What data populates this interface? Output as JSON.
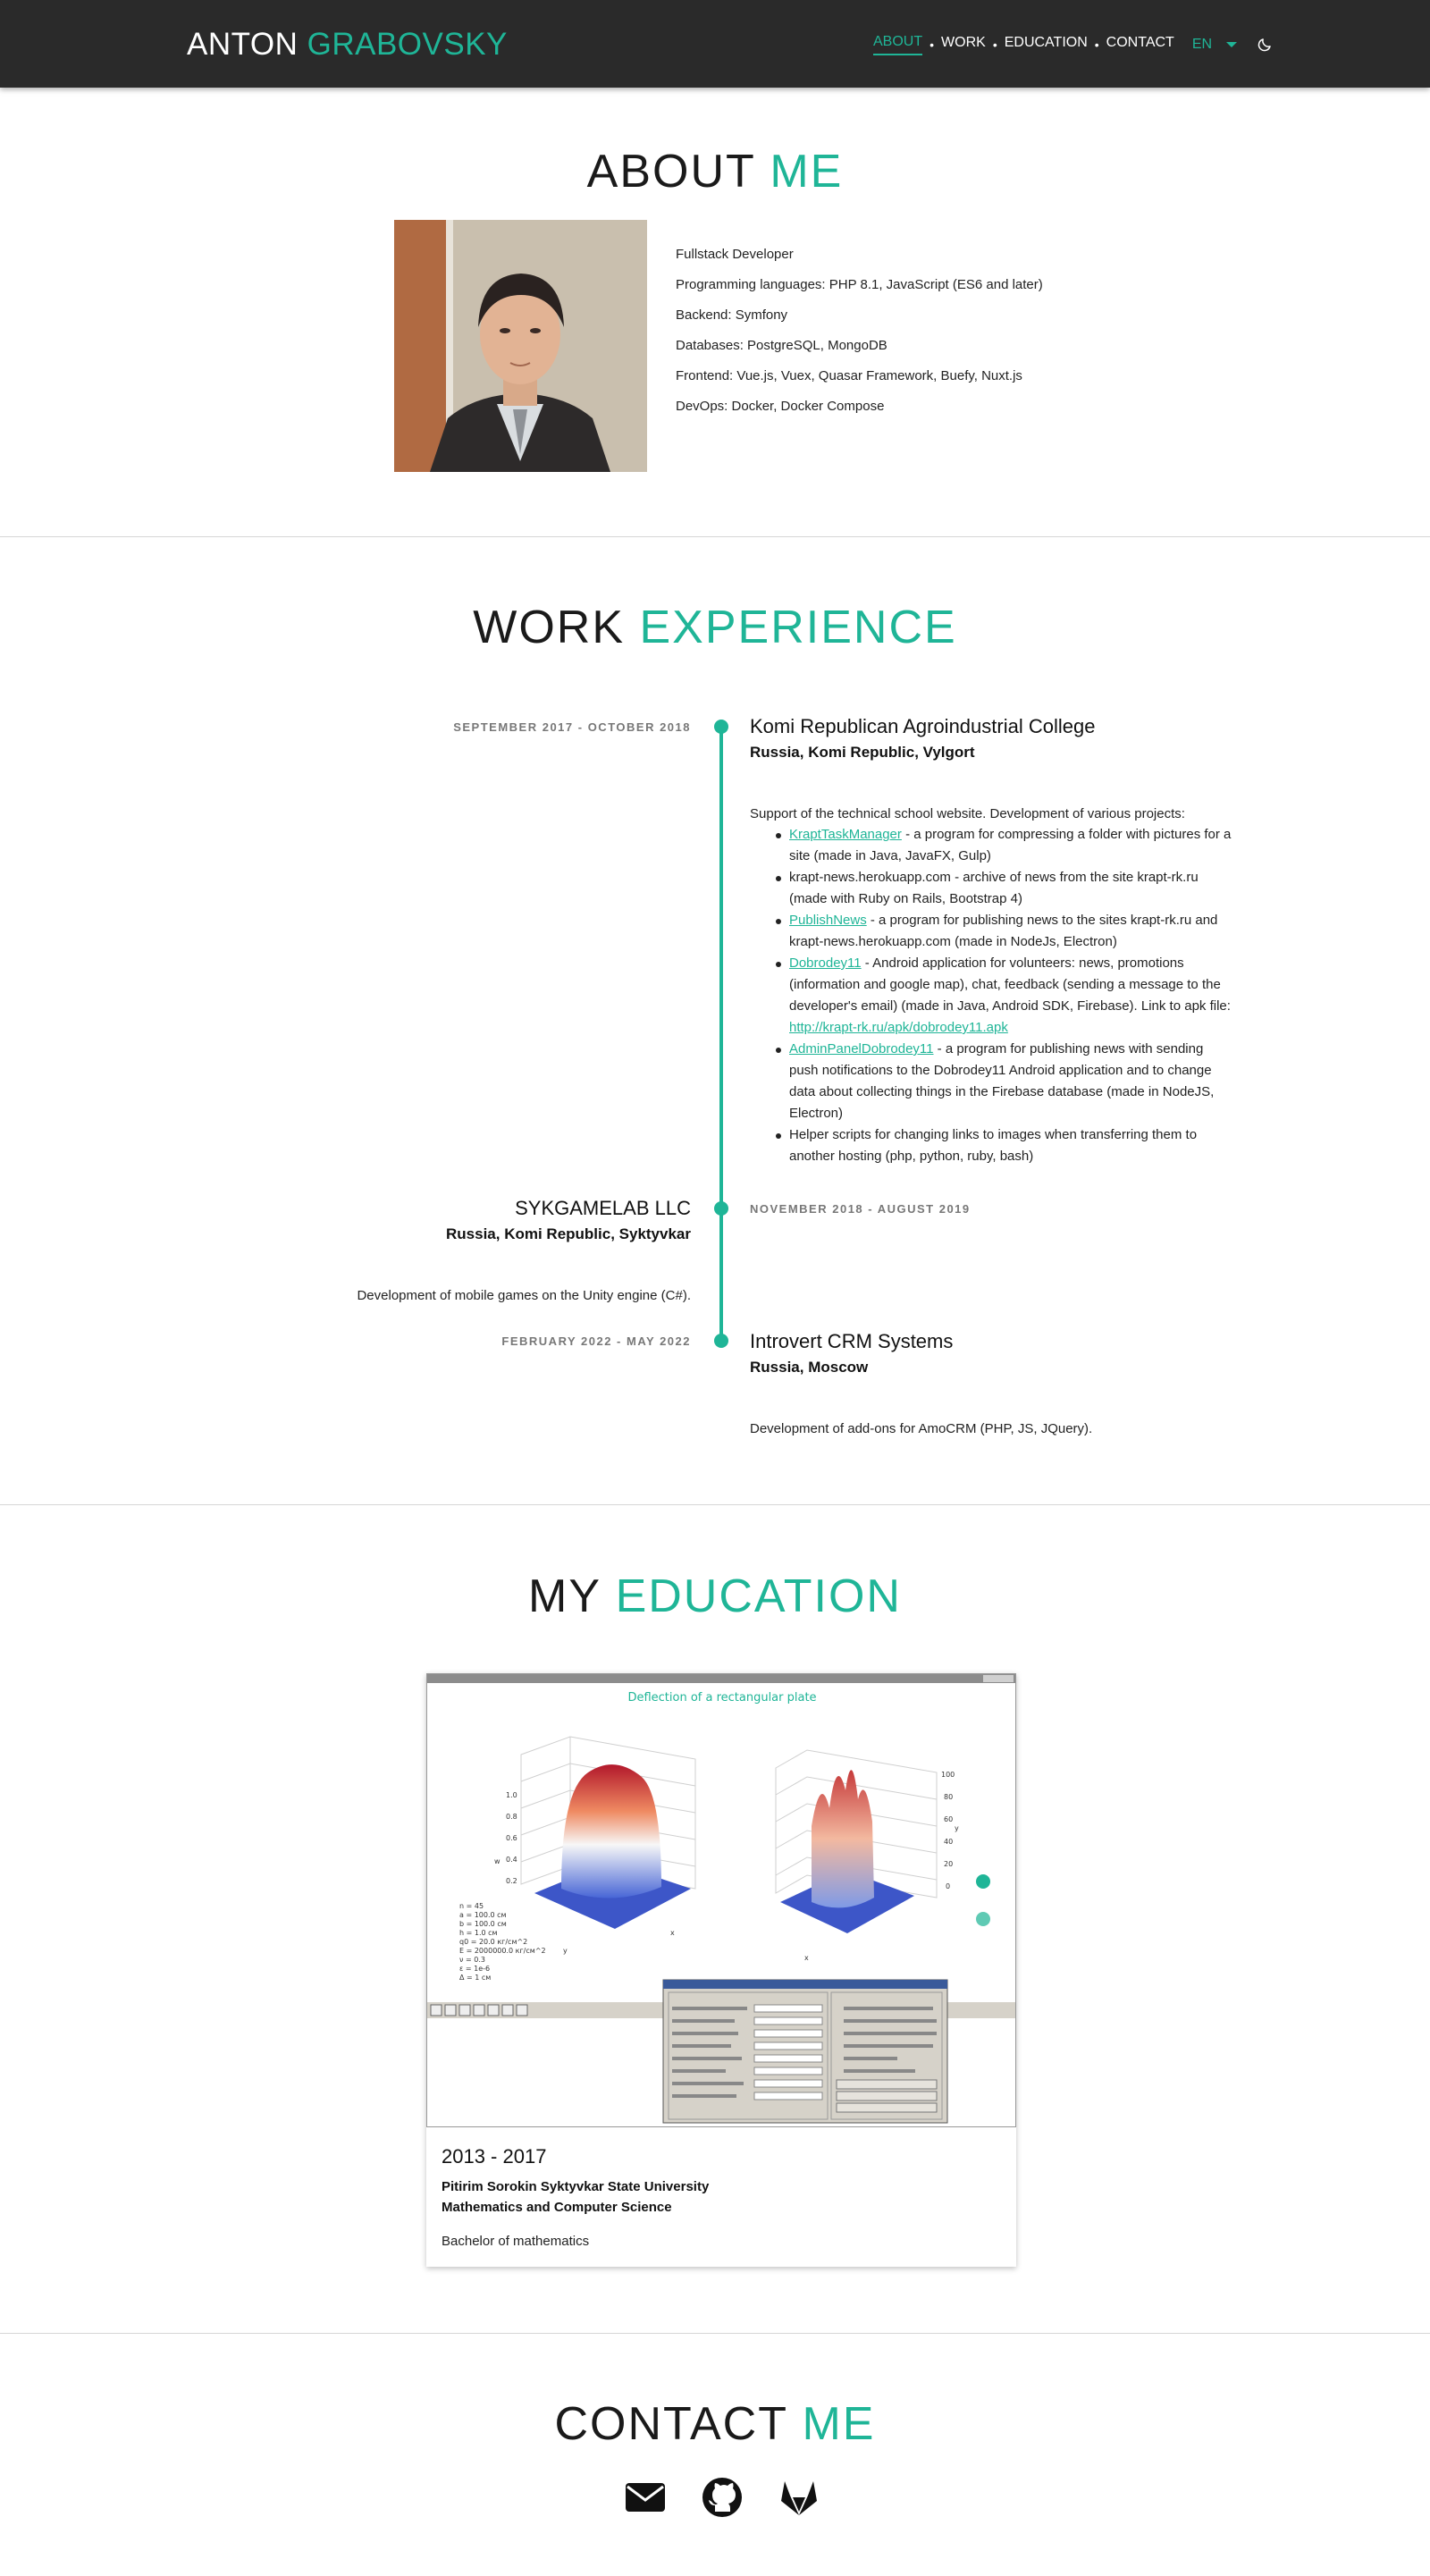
{
  "header": {
    "brand_first": "ANTON",
    "brand_last": "GRABOVSKY",
    "nav": [
      "ABOUT",
      "WORK",
      "EDUCATION",
      "CONTACT"
    ],
    "lang": "EN"
  },
  "about": {
    "title_a": "ABOUT",
    "title_b": "ME",
    "lines": [
      "Fullstack Developer",
      "Programming languages: PHP 8.1, JavaScript (ES6 and later)",
      "Backend: Symfony",
      "Databases: PostgreSQL, MongoDB",
      "Frontend: Vue.js, Vuex, Quasar Framework, Buefy, Nuxt.js",
      "DevOps: Docker, Docker Compose"
    ]
  },
  "work": {
    "title_a": "WORK",
    "title_b": "EXPERIENCE",
    "jobs": [
      {
        "date": "SEPTEMBER 2017 - OCTOBER 2018",
        "company": "Komi Republican Agroindustrial College",
        "location": "Russia, Komi Republic, Vylgort",
        "intro": "Support of the technical school website. Development of various projects:",
        "bullets": [
          {
            "link": "KraptTaskManager",
            "text": " - a program for compressing a folder with pictures for a site (made in Java, JavaFX, Gulp)"
          },
          {
            "link": "",
            "text": "krapt-news.herokuapp.com - archive of news from the site krapt-rk.ru (made with Ruby on Rails, Bootstrap 4)"
          },
          {
            "link": "PublishNews",
            "text": " - a program for publishing news to the sites krapt-rk.ru and krapt-news.herokuapp.com (made in NodeJs, Electron)"
          },
          {
            "link": "Dobrodey11",
            "text": " - Android application for volunteers: news, promotions (information and google map), chat, feedback (sending a message to the developer's email) (made in Java, Android SDK, Firebase). Link to apk file: ",
            "link2": "http://krapt-rk.ru/apk/dobrodey11.apk"
          },
          {
            "link": "AdminPanelDobrodey11",
            "text": " - a program for publishing news with sending push notifications to the Dobrodey11 Android application and to change data about collecting things in the Firebase database (made in NodeJS, Electron)"
          },
          {
            "link": "",
            "text": "Helper scripts for changing links to images when transferring them to another hosting (php, python, ruby, bash)"
          }
        ]
      },
      {
        "date": "NOVEMBER 2018 - AUGUST 2019",
        "company": "SYKGAMELAB LLC",
        "location": "Russia, Komi Republic, Syktyvkar",
        "intro": "Development of mobile games on the Unity engine (C#)."
      },
      {
        "date": "FEBRUARY 2022 - MAY 2022",
        "company": "Introvert CRM Systems",
        "location": "Russia, Moscow",
        "intro": "Development of add-ons for AmoCRM (PHP, JS, JQuery)."
      }
    ]
  },
  "education": {
    "title_a": "MY",
    "title_b": "EDUCATION",
    "screenshot_title": "Deflection of a rectangular plate",
    "years": "2013 - 2017",
    "university": "Pitirim Sorokin Syktyvkar State University",
    "faculty": "Mathematics and Computer Science",
    "degree": "Bachelor of mathematics",
    "carousel_slides": 2,
    "carousel_active": 1
  },
  "contact": {
    "title_a": "CONTACT",
    "title_b": "ME",
    "icons": [
      "email-icon",
      "github-icon",
      "gitlab-icon"
    ]
  },
  "colors": {
    "accent": "#1fb597",
    "navbar": "#2a2a2a"
  }
}
